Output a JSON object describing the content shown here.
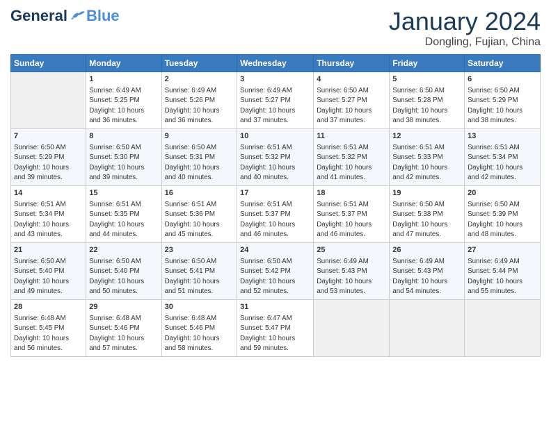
{
  "header": {
    "logo_general": "General",
    "logo_blue": "Blue",
    "month": "January 2024",
    "location": "Dongling, Fujian, China"
  },
  "days_of_week": [
    "Sunday",
    "Monday",
    "Tuesday",
    "Wednesday",
    "Thursday",
    "Friday",
    "Saturday"
  ],
  "weeks": [
    [
      {
        "day": null
      },
      {
        "day": 1,
        "sunrise": "6:49 AM",
        "sunset": "5:25 PM",
        "daylight": "10 hours and 36 minutes."
      },
      {
        "day": 2,
        "sunrise": "6:49 AM",
        "sunset": "5:26 PM",
        "daylight": "10 hours and 36 minutes."
      },
      {
        "day": 3,
        "sunrise": "6:49 AM",
        "sunset": "5:27 PM",
        "daylight": "10 hours and 37 minutes."
      },
      {
        "day": 4,
        "sunrise": "6:50 AM",
        "sunset": "5:27 PM",
        "daylight": "10 hours and 37 minutes."
      },
      {
        "day": 5,
        "sunrise": "6:50 AM",
        "sunset": "5:28 PM",
        "daylight": "10 hours and 38 minutes."
      },
      {
        "day": 6,
        "sunrise": "6:50 AM",
        "sunset": "5:29 PM",
        "daylight": "10 hours and 38 minutes."
      }
    ],
    [
      {
        "day": 7,
        "sunrise": "6:50 AM",
        "sunset": "5:29 PM",
        "daylight": "10 hours and 39 minutes."
      },
      {
        "day": 8,
        "sunrise": "6:50 AM",
        "sunset": "5:30 PM",
        "daylight": "10 hours and 39 minutes."
      },
      {
        "day": 9,
        "sunrise": "6:50 AM",
        "sunset": "5:31 PM",
        "daylight": "10 hours and 40 minutes."
      },
      {
        "day": 10,
        "sunrise": "6:51 AM",
        "sunset": "5:32 PM",
        "daylight": "10 hours and 40 minutes."
      },
      {
        "day": 11,
        "sunrise": "6:51 AM",
        "sunset": "5:32 PM",
        "daylight": "10 hours and 41 minutes."
      },
      {
        "day": 12,
        "sunrise": "6:51 AM",
        "sunset": "5:33 PM",
        "daylight": "10 hours and 42 minutes."
      },
      {
        "day": 13,
        "sunrise": "6:51 AM",
        "sunset": "5:34 PM",
        "daylight": "10 hours and 42 minutes."
      }
    ],
    [
      {
        "day": 14,
        "sunrise": "6:51 AM",
        "sunset": "5:34 PM",
        "daylight": "10 hours and 43 minutes."
      },
      {
        "day": 15,
        "sunrise": "6:51 AM",
        "sunset": "5:35 PM",
        "daylight": "10 hours and 44 minutes."
      },
      {
        "day": 16,
        "sunrise": "6:51 AM",
        "sunset": "5:36 PM",
        "daylight": "10 hours and 45 minutes."
      },
      {
        "day": 17,
        "sunrise": "6:51 AM",
        "sunset": "5:37 PM",
        "daylight": "10 hours and 46 minutes."
      },
      {
        "day": 18,
        "sunrise": "6:51 AM",
        "sunset": "5:37 PM",
        "daylight": "10 hours and 46 minutes."
      },
      {
        "day": 19,
        "sunrise": "6:50 AM",
        "sunset": "5:38 PM",
        "daylight": "10 hours and 47 minutes."
      },
      {
        "day": 20,
        "sunrise": "6:50 AM",
        "sunset": "5:39 PM",
        "daylight": "10 hours and 48 minutes."
      }
    ],
    [
      {
        "day": 21,
        "sunrise": "6:50 AM",
        "sunset": "5:40 PM",
        "daylight": "10 hours and 49 minutes."
      },
      {
        "day": 22,
        "sunrise": "6:50 AM",
        "sunset": "5:40 PM",
        "daylight": "10 hours and 50 minutes."
      },
      {
        "day": 23,
        "sunrise": "6:50 AM",
        "sunset": "5:41 PM",
        "daylight": "10 hours and 51 minutes."
      },
      {
        "day": 24,
        "sunrise": "6:50 AM",
        "sunset": "5:42 PM",
        "daylight": "10 hours and 52 minutes."
      },
      {
        "day": 25,
        "sunrise": "6:49 AM",
        "sunset": "5:43 PM",
        "daylight": "10 hours and 53 minutes."
      },
      {
        "day": 26,
        "sunrise": "6:49 AM",
        "sunset": "5:43 PM",
        "daylight": "10 hours and 54 minutes."
      },
      {
        "day": 27,
        "sunrise": "6:49 AM",
        "sunset": "5:44 PM",
        "daylight": "10 hours and 55 minutes."
      }
    ],
    [
      {
        "day": 28,
        "sunrise": "6:48 AM",
        "sunset": "5:45 PM",
        "daylight": "10 hours and 56 minutes."
      },
      {
        "day": 29,
        "sunrise": "6:48 AM",
        "sunset": "5:46 PM",
        "daylight": "10 hours and 57 minutes."
      },
      {
        "day": 30,
        "sunrise": "6:48 AM",
        "sunset": "5:46 PM",
        "daylight": "10 hours and 58 minutes."
      },
      {
        "day": 31,
        "sunrise": "6:47 AM",
        "sunset": "5:47 PM",
        "daylight": "10 hours and 59 minutes."
      },
      {
        "day": null
      },
      {
        "day": null
      },
      {
        "day": null
      }
    ]
  ]
}
